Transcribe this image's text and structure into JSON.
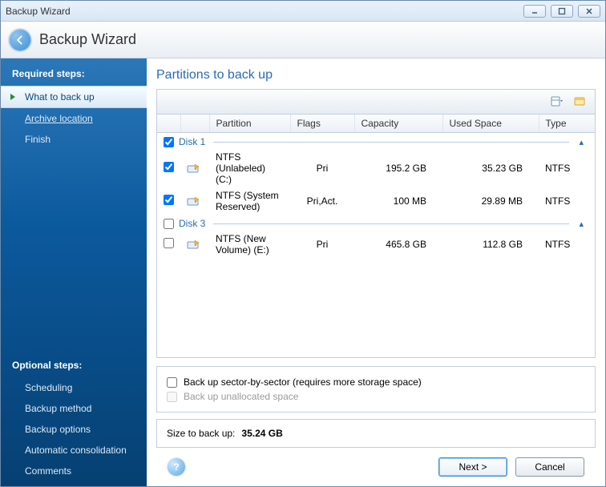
{
  "window": {
    "title": "Backup Wizard"
  },
  "header": {
    "title": "Backup Wizard"
  },
  "sidebar": {
    "required_title": "Required steps:",
    "optional_title": "Optional steps:",
    "required": [
      {
        "label": "What to back up",
        "active": true
      },
      {
        "label": "Archive location",
        "underline": true
      },
      {
        "label": "Finish"
      }
    ],
    "optional": [
      {
        "label": "Scheduling"
      },
      {
        "label": "Backup method"
      },
      {
        "label": "Backup options"
      },
      {
        "label": "Automatic consolidation"
      },
      {
        "label": "Comments"
      }
    ]
  },
  "main": {
    "heading": "Partitions to back up",
    "columns": {
      "partition": "Partition",
      "flags": "Flags",
      "capacity": "Capacity",
      "used": "Used Space",
      "type": "Type"
    },
    "disks": [
      {
        "name": "Disk 1",
        "checked": true,
        "partitions": [
          {
            "checked": true,
            "name": "NTFS (Unlabeled) (C:)",
            "flags": "Pri",
            "capacity": "195.2 GB",
            "used": "35.23 GB",
            "type": "NTFS"
          },
          {
            "checked": true,
            "name": "NTFS (System Reserved)",
            "flags": "Pri,Act.",
            "capacity": "100 MB",
            "used": "29.89 MB",
            "type": "NTFS"
          }
        ]
      },
      {
        "name": "Disk 3",
        "checked": false,
        "partitions": [
          {
            "checked": false,
            "name": "NTFS (New Volume) (E:)",
            "flags": "Pri",
            "capacity": "465.8 GB",
            "used": "112.8 GB",
            "type": "NTFS"
          }
        ]
      }
    ],
    "options": {
      "sector": "Back up sector-by-sector (requires more storage space)",
      "unalloc": "Back up unallocated space"
    },
    "size_label": "Size to back up:",
    "size_value": "35.24 GB"
  },
  "footer": {
    "next": "Next >",
    "cancel": "Cancel"
  }
}
